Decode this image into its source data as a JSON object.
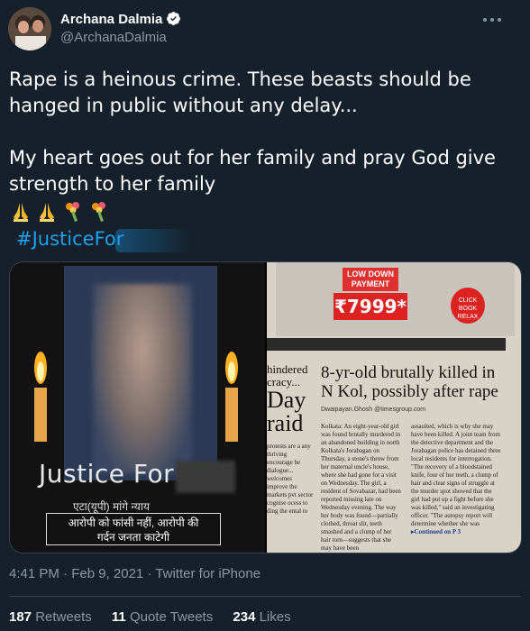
{
  "user": {
    "name": "Archana Dalmia",
    "handle": "@ArchanaDalmia"
  },
  "tweet": {
    "line1": "Rape is a heinous crime. These beasts should be",
    "line2": "hanged in public without any delay...",
    "line3": "My heart goes out for her family and pray God give",
    "line4": "strength to her family",
    "hashtag": "#JusticeFor"
  },
  "media": {
    "left": {
      "justice_text": "Justice For",
      "hindi_line": "एटा(यूपी) मांगे न्याय",
      "hindi_box_1": "आरोपी को फांसी नहीं, आरोपी की",
      "hindi_box_2": "गर्दन जनता काटेगी"
    },
    "right": {
      "ad_low": "LOW DOWN PAYMENT",
      "ad_price": "₹7999*",
      "ad_click": "CLICK BOOK RELAX",
      "side_head_1": "hindered",
      "side_head_2": "cracy...",
      "side_head_3": "Day",
      "side_head_4": "raid",
      "headline_1": "8-yr-old brutally killed in",
      "headline_2": "N Kol, possibly after rape",
      "byline": "Dwaipayan.Ghosh @timesgroup.com",
      "col1": "Kolkata: An eight-year-old girl was found brutally murdered in an abandoned building in north Kolkata's Jorabagan on Thursday, a stone's throw from her maternal uncle's house, where she had gone for a visit on Wednesday. The girl, a resident of Sovabazar, had been reported missing late on Wednesday evening. The way her body was found—partially clothed, throat slit, teeth smashed and a clump of her hair torn—suggests that she may have been",
      "col2": "assaulted, which is why she may have been killed. A joint team from the detective department and the Jorabagan police has detained three local residents for interrogation. \"The recovery of a bloodstained knife, four of her teeth, a clump of hair and clear signs of struggle at the murder spot showed that the girl had put up a fight before she was killed,\" said an investigating officer. \"The autopsy report will determine whether she was",
      "continued": "▸Continued on P 3",
      "col_side": "protests are a any thriving encourage be dialogue... welcomes improve the markets pvt sector cognise ocess to ding the ental to"
    }
  },
  "meta": {
    "time": "4:41 PM · Feb 9, 2021 · Twitter for iPhone"
  },
  "stats": {
    "retweets_count": "187",
    "retweets_label": "Retweets",
    "quotes_count": "11",
    "quotes_label": "Quote Tweets",
    "likes_count": "234",
    "likes_label": "Likes"
  }
}
